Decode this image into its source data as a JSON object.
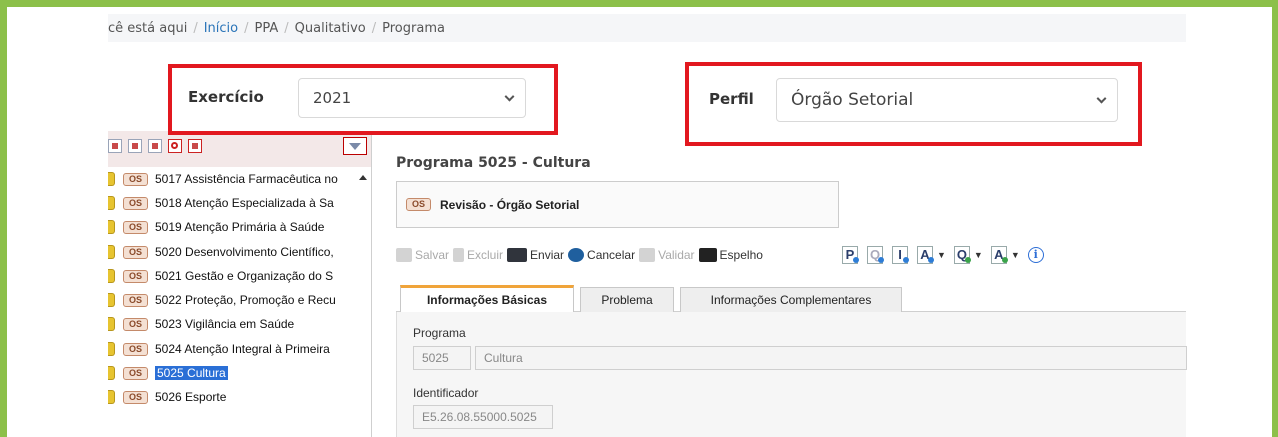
{
  "breadcrumb": {
    "prefix": "cê está aqui",
    "items": [
      "Início",
      "PPA",
      "Qualitativo",
      "Programa"
    ]
  },
  "selectors": {
    "exercicio": {
      "label": "Exercício",
      "value": "2021"
    },
    "perfil": {
      "label": "Perfil",
      "value": "Órgão Setorial"
    }
  },
  "tree": {
    "badge": "OS",
    "items": [
      {
        "label": "5017 Assistência Farmacêutica no"
      },
      {
        "label": "5018 Atenção Especializada à Sa"
      },
      {
        "label": "5019 Atenção Primária à Saúde"
      },
      {
        "label": "5020 Desenvolvimento Científico,"
      },
      {
        "label": "5021 Gestão e Organização do S"
      },
      {
        "label": "5022 Proteção, Promoção e Recu"
      },
      {
        "label": "5023 Vigilância em Saúde"
      },
      {
        "label": "5024 Atenção Integral à Primeira"
      },
      {
        "label": "5025 Cultura",
        "selected": true
      },
      {
        "label": "5026 Esporte"
      }
    ]
  },
  "program": {
    "title": "Programa 5025 - Cultura",
    "status_badge": "OS",
    "status": "Revisão - Órgão Setorial"
  },
  "actions": {
    "salvar": "Salvar",
    "excluir": "Excluir",
    "enviar": "Enviar",
    "cancelar": "Cancelar",
    "validar": "Validar",
    "espelho": "Espelho"
  },
  "format_buttons": [
    "P",
    "Q",
    "I",
    "A",
    "Q",
    "A"
  ],
  "tabs": [
    "Informações Básicas",
    "Problema",
    "Informações Complementares"
  ],
  "form": {
    "programa_label": "Programa",
    "programa_code": "5025",
    "programa_name": "Cultura",
    "identificador_label": "Identificador",
    "identificador_value": "E5.26.08.55000.5025"
  },
  "colors": {
    "frame": "#8cc04a",
    "highlight": "#e2181f",
    "active_tab": "#f0a43a",
    "selection": "#2a6fd6"
  }
}
